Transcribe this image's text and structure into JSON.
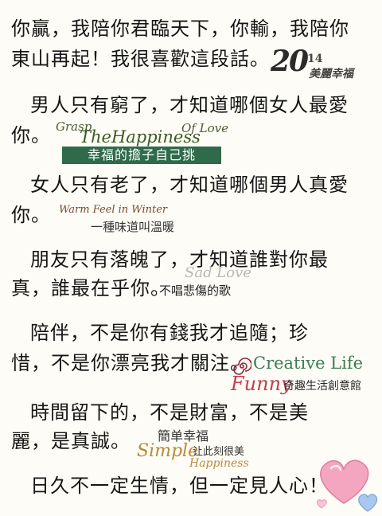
{
  "paragraphs": [
    [
      "你贏，我陪你君臨天下，你輸，我陪你",
      "東山再起！我很喜歡這段話。"
    ],
    [
      "男人只有窮了，才知道哪個女人最愛",
      "你。"
    ],
    [
      "女人只有老了，才知道哪個男人真愛",
      "你。"
    ],
    [
      "朋友只有落魄了，才知道誰對你最",
      "真，誰最在乎你。"
    ],
    [
      "陪伴，不是你有錢我才追隨；珍",
      "惜，不是你漂亮我才關注。"
    ],
    [
      "時間留下的，不是財富，不是美",
      "麗，是真誠。"
    ],
    [
      "日久不一定生情，但一定見人心！"
    ]
  ],
  "decorations": {
    "logo_2014": {
      "year": "20",
      "year_small": "14",
      "subtitle": "美麗幸福"
    },
    "grasp": {
      "word1": "Grasp",
      "word2": "TheHappiness",
      "word3": "Of Love",
      "banner": "幸福的擔子自己挑"
    },
    "warm": {
      "english": "Warm Feel in Winter",
      "chinese": "一種味道叫溫暖"
    },
    "sad": {
      "english": "Sad Love",
      "chinese": "不唱悲傷的歌"
    },
    "creative": {
      "english1": "Creative Life",
      "english2": "Funny",
      "chinese": "奇趣生活創意館"
    },
    "simple": {
      "chinese1": "簡单幸福",
      "english1": "Simple",
      "chinese2": "让此刻很美",
      "english2": "Happiness"
    }
  },
  "colors": {
    "background": "#fdfcf6",
    "text": "#161616",
    "banner_green": "#2f6b4a",
    "heart_pink": "#f4a6c0",
    "heart_blue": "#a8c8f0"
  },
  "icons": [
    "heart-icon",
    "spiral-icon"
  ]
}
